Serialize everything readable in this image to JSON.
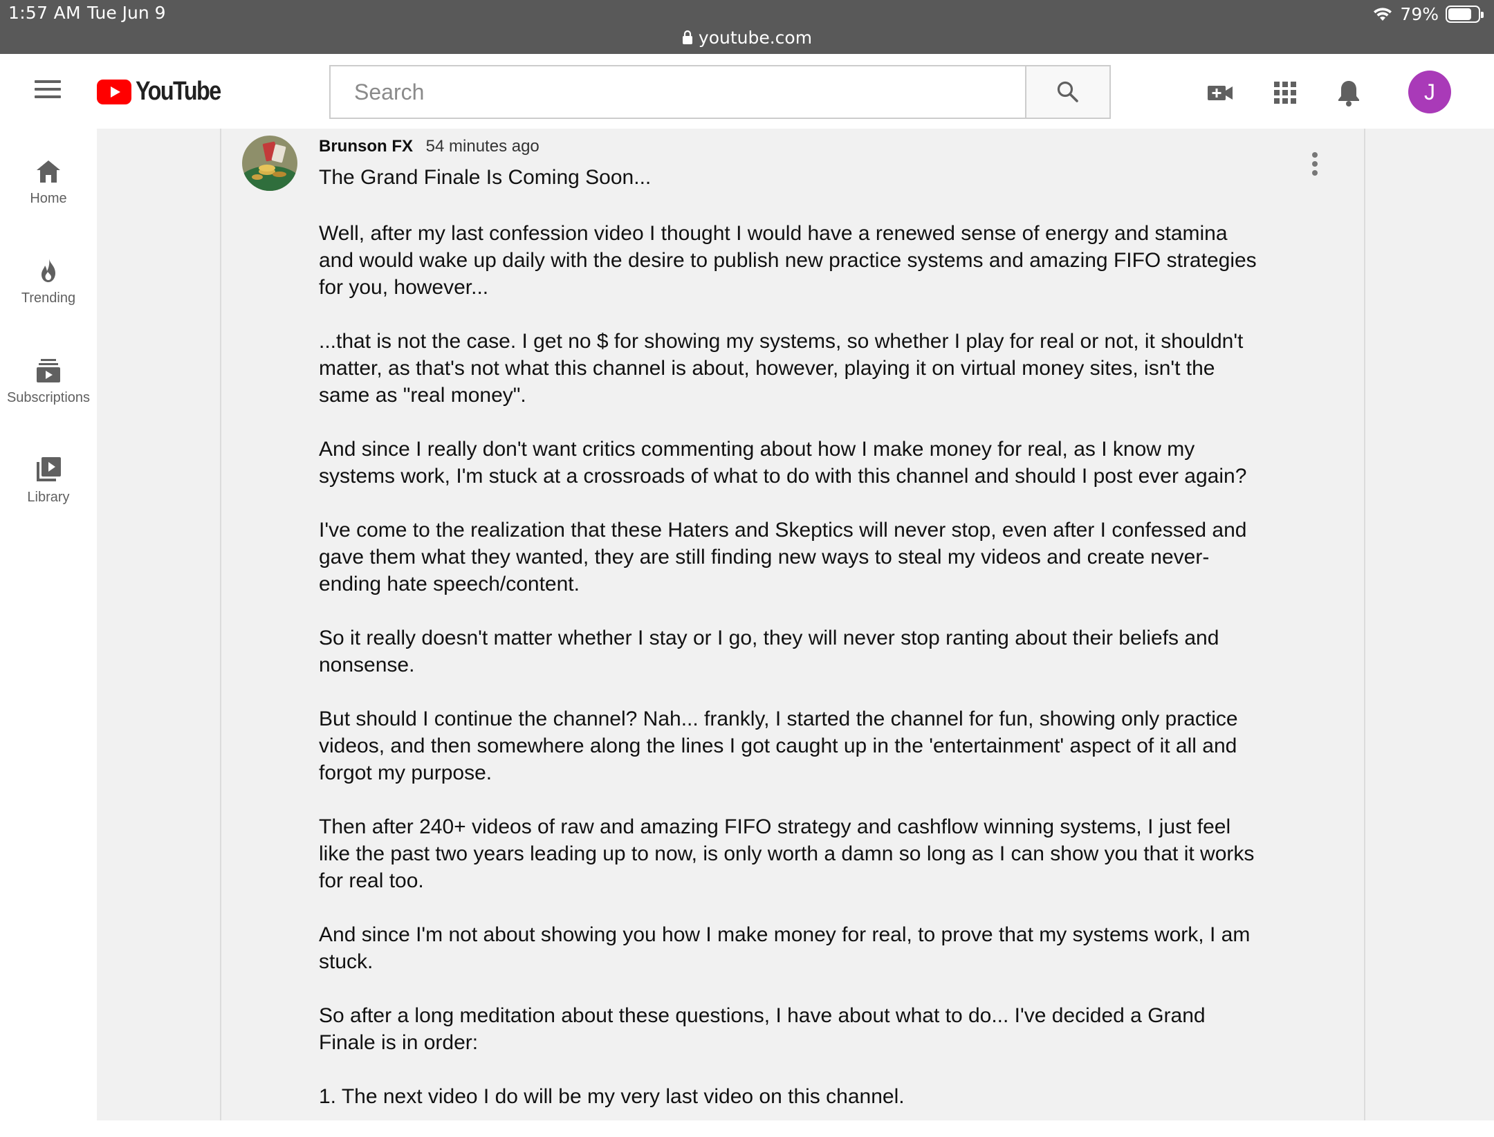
{
  "status_bar": {
    "time": "1:57 AM",
    "date": "Tue Jun 9",
    "battery": "79%",
    "battery_level": 0.79,
    "url": "youtube.com"
  },
  "header": {
    "logo_text": "YouTube",
    "search_placeholder": "Search",
    "avatar_initial": "J",
    "avatar_color": "#a93ab8"
  },
  "sidebar": {
    "items": [
      {
        "label": "Home",
        "icon": "home-icon"
      },
      {
        "label": "Trending",
        "icon": "trending-icon"
      },
      {
        "label": "Subscriptions",
        "icon": "subscriptions-icon"
      },
      {
        "label": "Library",
        "icon": "library-icon"
      }
    ]
  },
  "post": {
    "author": "Brunson FX",
    "time_ago": "54 minutes ago",
    "title": "The Grand Finale Is Coming Soon...",
    "paragraphs": [
      "Well, after my last confession video I thought I would have a renewed sense of energy and stamina\nand would wake up daily with the desire to publish new practice systems and amazing FIFO strategies\nfor you, however...",
      "...that is not the case. I get no $ for showing my systems, so whether I play for real or not, it shouldn't\nmatter, as that's not what this channel is about, however, playing it on virtual money sites, isn't the\nsame as \"real money\".",
      "And since I really don't want critics commenting about how I make money for real, as I know my\nsystems work, I'm stuck at a crossroads of what to do with this channel and should I post ever again?",
      "I've come to the realization that these Haters and Skeptics will never stop, even after I confessed and\ngave them what they wanted, they are still finding new ways to steal my videos and create never-\nending hate speech/content.",
      "So it really doesn't matter whether I stay or I go, they will never stop ranting about their beliefs and\nnonsense.",
      "But should I continue the channel? Nah... frankly, I started the channel for fun, showing only practice\nvideos, and then somewhere along the lines I got caught up in the 'entertainment' aspect of it all and\nforgot my purpose.",
      "Then after 240+ videos of raw and amazing FIFO strategy and cashflow winning systems, I just feel\nlike the past two years leading up to now, is only worth a damn so long as I can show you that it works\nfor real too.",
      "And since I'm not about showing you how I make money for real, to prove that my systems work, I am\nstuck.",
      "So after a long meditation about these questions, I have about what to do... I've decided a Grand\nFinale is in order:",
      "1. The next video I do will be my very last video on this channel."
    ]
  }
}
